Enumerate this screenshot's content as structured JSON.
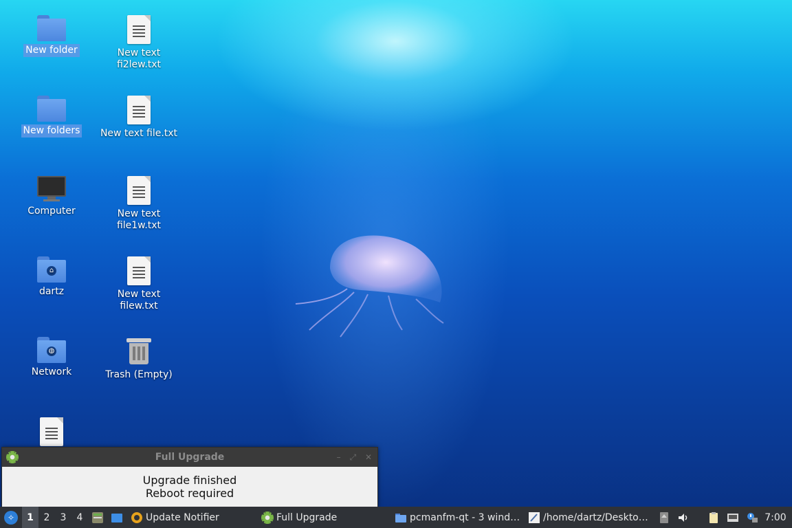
{
  "desktop": {
    "icons": [
      {
        "label": "New folder",
        "type": "folder"
      },
      {
        "label": "New text\nfi2lew.txt",
        "type": "text-file"
      },
      {
        "label": "New folders",
        "type": "folder"
      },
      {
        "label": "New text file.txt",
        "type": "text-file"
      },
      {
        "label": "Computer",
        "type": "computer"
      },
      {
        "label": "New text\nfile1w.txt",
        "type": "text-file"
      },
      {
        "label": "dartz",
        "type": "home-folder"
      },
      {
        "label": "New text\nfilew.txt",
        "type": "text-file"
      },
      {
        "label": "Network",
        "type": "network-folder"
      },
      {
        "label": "Trash (Empty)",
        "type": "trash"
      }
    ]
  },
  "dialog": {
    "title": "Full Upgrade",
    "message_line1": "Upgrade finished",
    "message_line2": "Reboot required",
    "controls": {
      "minimize": "–",
      "maximize": "⤢",
      "close": "✕"
    }
  },
  "taskbar": {
    "desktops": [
      "1",
      "2",
      "3",
      "4"
    ],
    "active_desktop": "1",
    "tasks": [
      {
        "label": "Update Notifier",
        "icon": "update-notifier-icon"
      },
      {
        "label": "Full Upgrade",
        "icon": "gear-icon"
      },
      {
        "label": "pcmanfm-qt - 3 wind…",
        "icon": "folder-icon"
      },
      {
        "label": "/home/dartz/Deskto…",
        "icon": "text-editor-icon"
      }
    ],
    "clock": "7:00"
  },
  "colors": {
    "taskbar_bg": "#2f3237",
    "dialog_title_bg": "#3a3a3a",
    "selection": "#6096e6",
    "accent_green": "#7ab648"
  }
}
